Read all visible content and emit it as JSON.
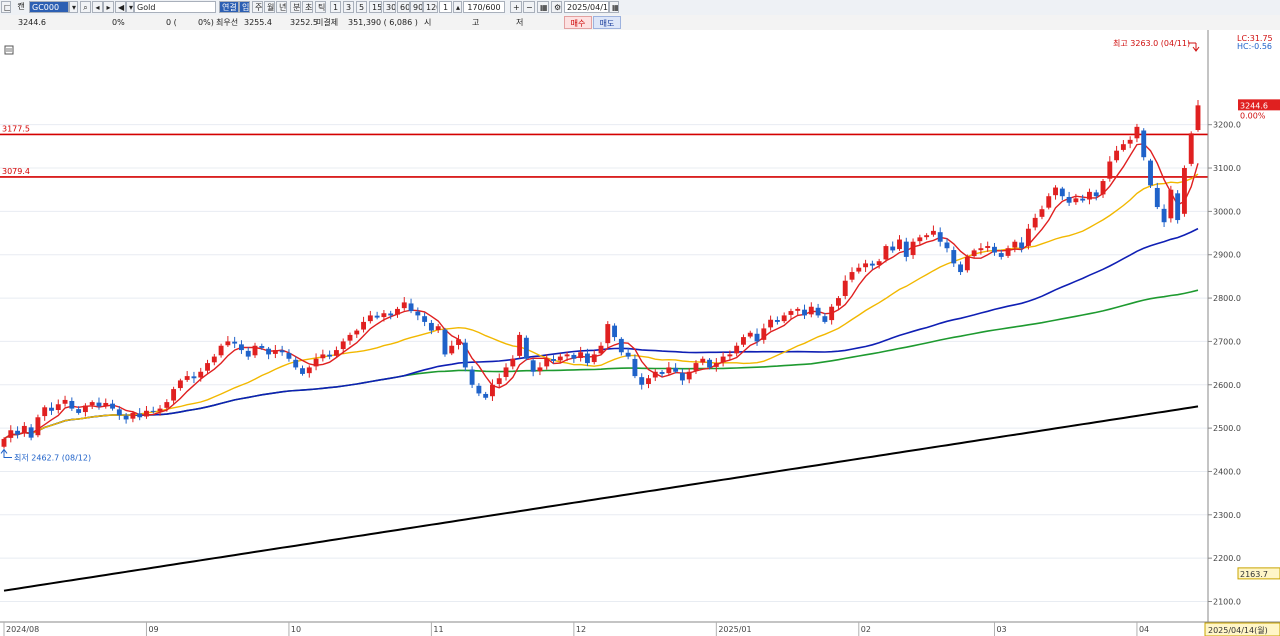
{
  "toolbar": {
    "tab_label": "캔",
    "code_value": "GC000",
    "name_value": "Gold",
    "mode_label": "연결",
    "mode_button": "입",
    "periods": [
      "주",
      "월",
      "년",
      "분",
      "초",
      "틱"
    ],
    "intervals": [
      "1",
      "3",
      "5",
      "15",
      "30",
      "60",
      "90",
      "120"
    ],
    "count_value": "1",
    "range_value": "170/600",
    "date_value": "2025/04/14"
  },
  "quote": {
    "price": "3244.6",
    "change_pct": "0%",
    "change_zero": "0 (",
    "change_pct2": "0%)",
    "prev_label": "최우선",
    "prev_value": "3255.4",
    "ask_value": "3252.5",
    "open_interest_label": "미결제",
    "open_interest": "351,390 ( 6,086 )",
    "open_label": "시",
    "high_label": "고",
    "low_label": "저",
    "buy_label": "매수",
    "sell_label": "매도"
  },
  "colors": {
    "up": "#e02020",
    "down": "#1f62c9",
    "ma5": "#e02020",
    "ma20": "#f2b800",
    "ma60": "#0f1fb4",
    "ma120": "#1e9a30",
    "ma240": "#000000",
    "hline": "#d40000"
  },
  "chart_data": {
    "type": "candlestick",
    "price_ticks": [
      "3200.0",
      "3100.0",
      "3000.0",
      "2900.0",
      "2800.0",
      "2700.0",
      "2600.0",
      "2500.0",
      "2400.0",
      "2300.0",
      "2200.0",
      "2100.0"
    ],
    "ylim": [
      2085,
      3340
    ],
    "date_ticks": [
      "2024/08",
      "09",
      "10",
      "11",
      "12",
      "2025/01",
      "02",
      "03",
      "04"
    ],
    "last_date_label": "2025/04/14(월)",
    "last_price_label": "3244.6",
    "last_change_label": "0.00%",
    "side_value_label": "2163.7",
    "lc_label": "LC:31.75",
    "hc_label": "HC:-0.56",
    "high_annotation": "최고 3263.0 (04/11)",
    "low_annotation": "최저 2462.7 (08/12)",
    "hlines": [
      {
        "label": "3177.5",
        "value": 3177.5
      },
      {
        "label": "3079.4",
        "value": 3079.4
      }
    ],
    "closes": [
      2475,
      2495,
      2485,
      2505,
      2478,
      2525,
      2548,
      2540,
      2555,
      2565,
      2545,
      2535,
      2552,
      2560,
      2550,
      2558,
      2545,
      2530,
      2520,
      2535,
      2525,
      2540,
      2538,
      2545,
      2560,
      2590,
      2610,
      2620,
      2615,
      2630,
      2650,
      2665,
      2690,
      2700,
      2695,
      2680,
      2665,
      2690,
      2685,
      2670,
      2680,
      2675,
      2660,
      2640,
      2625,
      2640,
      2660,
      2670,
      2665,
      2680,
      2700,
      2715,
      2725,
      2745,
      2760,
      2755,
      2765,
      2760,
      2775,
      2790,
      2770,
      2760,
      2745,
      2725,
      2735,
      2670,
      2690,
      2705,
      2640,
      2600,
      2580,
      2570,
      2600,
      2615,
      2640,
      2660,
      2715,
      2660,
      2630,
      2640,
      2660,
      2655,
      2665,
      2670,
      2660,
      2675,
      2650,
      2670,
      2690,
      2740,
      2710,
      2675,
      2665,
      2620,
      2600,
      2615,
      2630,
      2625,
      2640,
      2630,
      2610,
      2630,
      2650,
      2660,
      2640,
      2650,
      2665,
      2670,
      2690,
      2710,
      2720,
      2700,
      2730,
      2750,
      2745,
      2760,
      2770,
      2775,
      2760,
      2780,
      2760,
      2745,
      2780,
      2800,
      2840,
      2860,
      2870,
      2880,
      2875,
      2885,
      2920,
      2910,
      2935,
      2895,
      2930,
      2940,
      2945,
      2955,
      2930,
      2915,
      2880,
      2860,
      2895,
      2910,
      2915,
      2920,
      2905,
      2895,
      2915,
      2930,
      2915,
      2960,
      2985,
      3005,
      3035,
      3055,
      3035,
      3020,
      3030,
      3025,
      3045,
      3035,
      3070,
      3115,
      3140,
      3155,
      3165,
      3195,
      3125,
      3060,
      3010,
      2975,
      3050,
      2980,
      3100,
      3180,
      3244.6
    ]
  }
}
